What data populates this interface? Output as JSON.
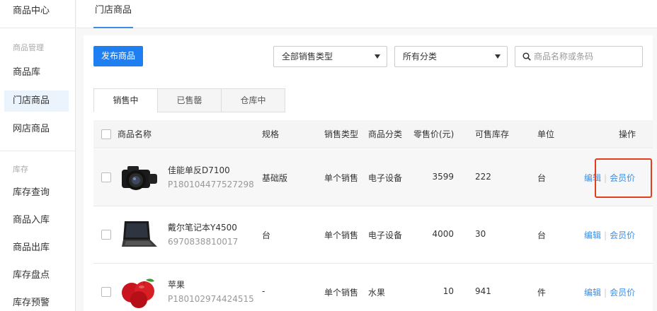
{
  "sidebar": {
    "top_title": "商品中心",
    "group1": "商品管理",
    "items1": [
      "商品库",
      "门店商品",
      "网店商品"
    ],
    "group2": "库存",
    "items2": [
      "库存查询",
      "商品入库",
      "商品出库",
      "库存盘点",
      "库存预警"
    ]
  },
  "topbar": {
    "tab": "门店商品"
  },
  "toolbar": {
    "publish_label": "发布商品",
    "select_sale_type": "全部销售类型",
    "select_category": "所有分类",
    "search_placeholder": "商品名称或条码"
  },
  "status_tabs": [
    "销售中",
    "已售罄",
    "仓库中"
  ],
  "table": {
    "headers": [
      "商品名称",
      "规格",
      "销售类型",
      "商品分类",
      "零售价(元)",
      "可售库存",
      "单位",
      "操作"
    ],
    "rows": [
      {
        "name": "佳能单反D7100",
        "code": "P180104477527298",
        "spec": "基础版",
        "sale_type": "单个销售",
        "category": "电子设备",
        "price": "3599",
        "stock": "222",
        "unit": "台",
        "op_edit": "编辑",
        "op_member": "会员价"
      },
      {
        "name": "戴尔笔记本Y4500",
        "code": "6970838810017",
        "spec": "台",
        "sale_type": "单个销售",
        "category": "电子设备",
        "price": "4000",
        "stock": "30",
        "unit": "台",
        "op_edit": "编辑",
        "op_member": "会员价"
      },
      {
        "name": "苹果",
        "code": "P180102974424515",
        "spec": "-",
        "sale_type": "单个销售",
        "category": "水果",
        "price": "10",
        "stock": "941",
        "unit": "件",
        "op_edit": "编辑",
        "op_member": "会员价"
      }
    ]
  },
  "colors": {
    "primary": "#1f7ff0",
    "link": "#3a8ee6",
    "highlight": "#e63c1e"
  }
}
